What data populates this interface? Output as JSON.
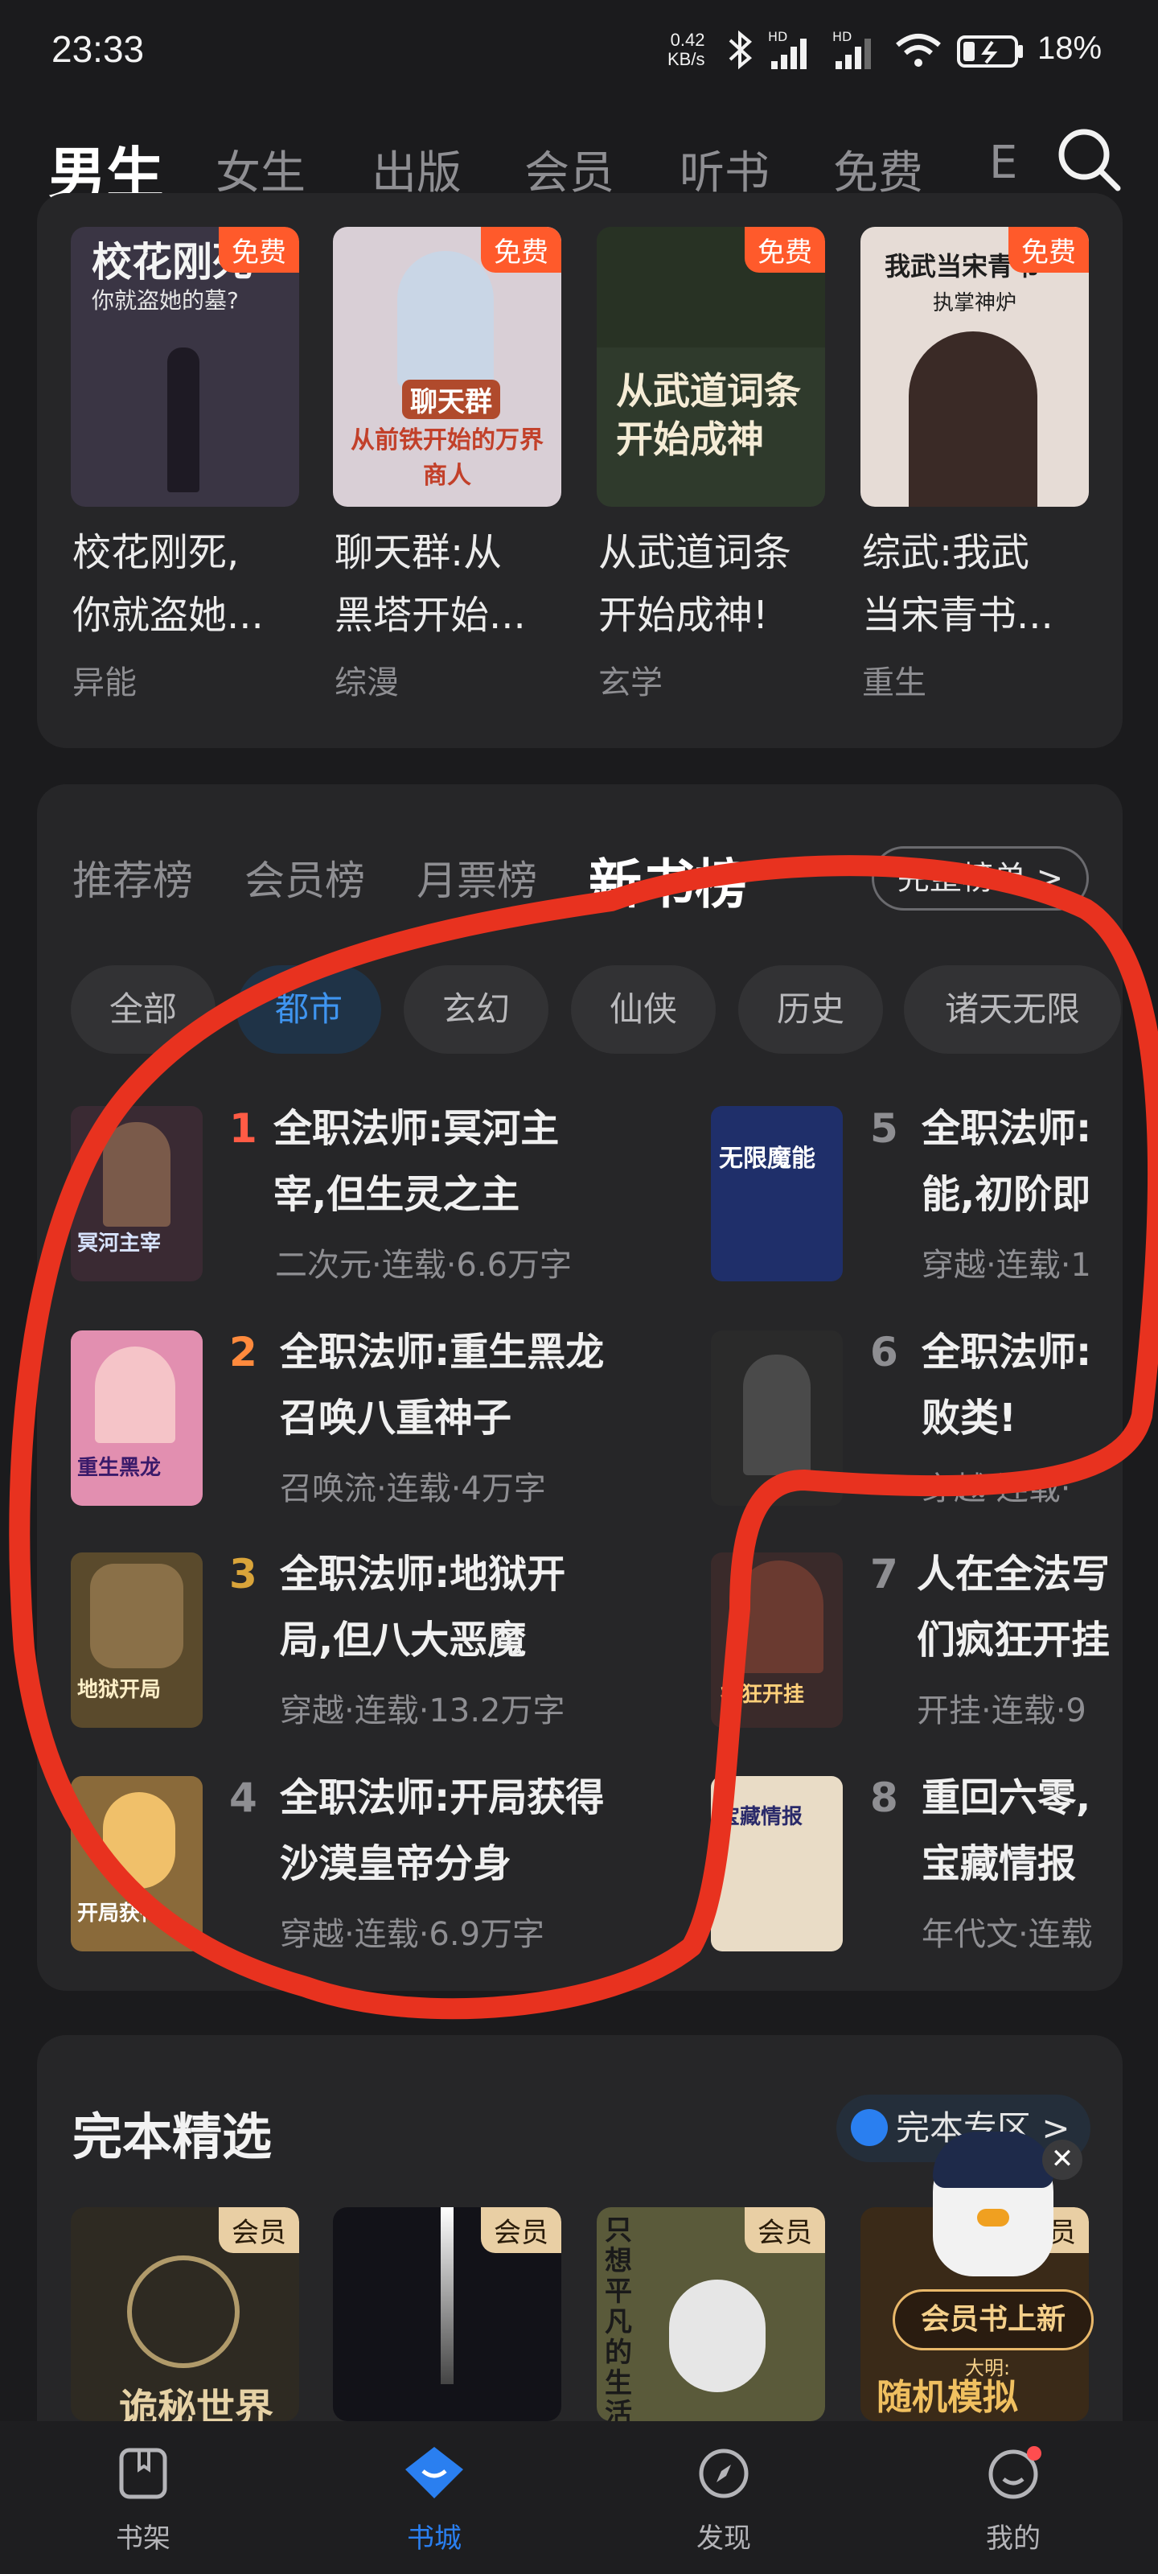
{
  "status_bar": {
    "time": "23:33",
    "net_speed_value": "0.42",
    "net_speed_unit": "KB/s",
    "hd1": "HD",
    "hd2": "HD",
    "battery": "18%"
  },
  "top_nav": {
    "tabs": [
      "男生",
      "女生",
      "出版",
      "会员",
      "听书",
      "免费",
      "E"
    ],
    "active_index": 0
  },
  "top_books": [
    {
      "cover_title": "校花刚死",
      "cover_sub": "你就盗她的墓?",
      "badge": "免费",
      "title_line1": "校花刚死,",
      "title_line2": "你就盗她...",
      "tag": "异能",
      "cover_color": "#3a3544"
    },
    {
      "cover_title": "聊天群",
      "cover_sub": "从前铁开始的万界商人",
      "badge": "免费",
      "title_line1": "聊天群:从",
      "title_line2": "黑塔开始...",
      "tag": "综漫",
      "cover_color": "#d9cfd6"
    },
    {
      "cover_title": "从武道词条",
      "cover_sub": "开始成神",
      "badge": "免费",
      "title_line1": "从武道词条",
      "title_line2": "开始成神!",
      "tag": "玄学",
      "cover_color": "#2f3a2c"
    },
    {
      "cover_title": "我武当宋青书",
      "cover_sub": "执掌神炉",
      "badge": "免费",
      "title_line1": "综武:我武",
      "title_line2": "当宋青书...",
      "tag": "重生",
      "cover_color": "#e6dcd6"
    }
  ],
  "ranking": {
    "tabs": [
      "推荐榜",
      "会员榜",
      "月票榜",
      "新书榜"
    ],
    "active_tab": 3,
    "full_list_label": "完整榜单 >",
    "chips": [
      "全部",
      "都市",
      "玄幻",
      "仙侠",
      "历史",
      "诸天无限"
    ],
    "active_chip": 1,
    "items": [
      {
        "rank": "1",
        "title_line1": "全职法师:冥河主",
        "title_line2": "宰,但生灵之主",
        "meta": "二次元·连载·6.6万字",
        "cover_text": "冥河主宰",
        "cover_color": "#3a2a33",
        "rank_color": "#ff5b45"
      },
      {
        "rank": "2",
        "title_line1": "全职法师:重生黑龙",
        "title_line2": "召唤八重神子",
        "meta": "召唤流·连载·4万字",
        "cover_text": "重生黑龙",
        "cover_color": "#e28fb0",
        "rank_color": "#ff8a3d"
      },
      {
        "rank": "3",
        "title_line1": "全职法师:地狱开",
        "title_line2": "局,但八大恶魔",
        "meta": "穿越·连载·13.2万字",
        "cover_text": "地狱开局",
        "cover_color": "#5a4a2c",
        "rank_color": "#d9a43a"
      },
      {
        "rank": "4",
        "title_line1": "全职法师:开局获得",
        "title_line2": "沙漠皇帝分身",
        "meta": "穿越·连载·6.9万字",
        "cover_text": "开局获得",
        "cover_color": "#8a6a3a",
        "rank_color": "#8e8e92"
      },
      {
        "rank": "5",
        "title_line1": "全职法师:",
        "title_line2": "能,初阶即",
        "meta": "穿越·连载·1",
        "cover_text": "无限魔能",
        "cover_color": "#1f2f6a",
        "rank_color": "#8e8e92"
      },
      {
        "rank": "6",
        "title_line1": "全职法师:",
        "title_line2": "败类!",
        "meta": "穿越·连载·",
        "cover_text": "",
        "cover_color": "#2a2a2a",
        "rank_color": "#8e8e92"
      },
      {
        "rank": "7",
        "title_line1": "人在全法写",
        "title_line2": "们疯狂开挂",
        "meta": "开挂·连载·9",
        "cover_text": "疯狂开挂",
        "cover_color": "#3a2a2a",
        "rank_color": "#8e8e92"
      },
      {
        "rank": "8",
        "title_line1": "重回六零,",
        "title_line2": "宝藏情报",
        "meta": "年代文·连载",
        "cover_text": "宝藏情报",
        "cover_color": "#e9dcc6",
        "rank_color": "#8e8e92"
      }
    ]
  },
  "finished": {
    "title": "完本精选",
    "zone_label": "完本专区 >",
    "books": [
      {
        "badge": "会员",
        "cover_color": "#2e2a22",
        "cover_text": "诡秘世界"
      },
      {
        "badge": "会员",
        "cover_color": "#121218",
        "cover_text": ""
      },
      {
        "badge": "会员",
        "cover_color": "#5a5a3a",
        "cover_text": "只想平凡的生活"
      },
      {
        "badge": "会员",
        "cover_color": "#3a2a18",
        "cover_text": "随机模拟"
      }
    ],
    "promo_label": "会员书上新",
    "promo_sub": "大明:"
  },
  "bottom_nav": {
    "items": [
      "书架",
      "书城",
      "发现",
      "我的"
    ],
    "active_index": 1
  },
  "colors": {
    "accent": "#2a7ff0",
    "free_badge": "#ff5a2b",
    "vip_badge": "#e9cfa4",
    "annotation": "#e8321f"
  }
}
